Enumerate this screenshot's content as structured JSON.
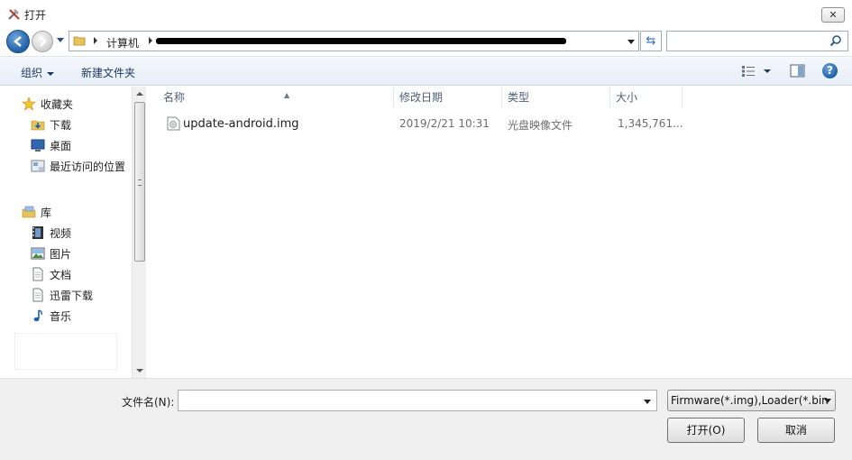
{
  "window": {
    "title": "打开",
    "close_label": "✕"
  },
  "address": {
    "root": "计算机",
    "path_redacted": true
  },
  "search": {
    "placeholder": ""
  },
  "toolbar": {
    "organize": "组织",
    "new_folder": "新建文件夹"
  },
  "nav": {
    "favorites": [
      {
        "label": "收藏夹",
        "icon": "star-icon"
      },
      {
        "label": "下载",
        "icon": "download-folder-icon"
      },
      {
        "label": "桌面",
        "icon": "desktop-icon"
      },
      {
        "label": "最近访问的位置",
        "icon": "recent-places-icon"
      }
    ],
    "libraries": [
      {
        "label": "库",
        "icon": "library-icon"
      },
      {
        "label": "视频",
        "icon": "video-icon"
      },
      {
        "label": "图片",
        "icon": "picture-icon"
      },
      {
        "label": "文档",
        "icon": "document-icon"
      },
      {
        "label": "迅雷下载",
        "icon": "thunder-download-icon"
      },
      {
        "label": "音乐",
        "icon": "music-icon"
      }
    ]
  },
  "columns": {
    "name": "名称",
    "date": "修改日期",
    "type": "类型",
    "size": "大小"
  },
  "files": [
    {
      "name": "update-android.img",
      "date": "2019/2/21 10:31",
      "type": "光盘映像文件",
      "size": "1,345,761..."
    }
  ],
  "bottom": {
    "filename_label": "文件名(N):",
    "filename_value": "",
    "filter": "Firmware(*.img),Loader(*.bin",
    "open_label": "打开(O)",
    "cancel_label": "取消"
  },
  "colors": {
    "accent": "#1f5fa8",
    "toolbar_text": "#1e3963",
    "header_text": "#4c607a"
  }
}
